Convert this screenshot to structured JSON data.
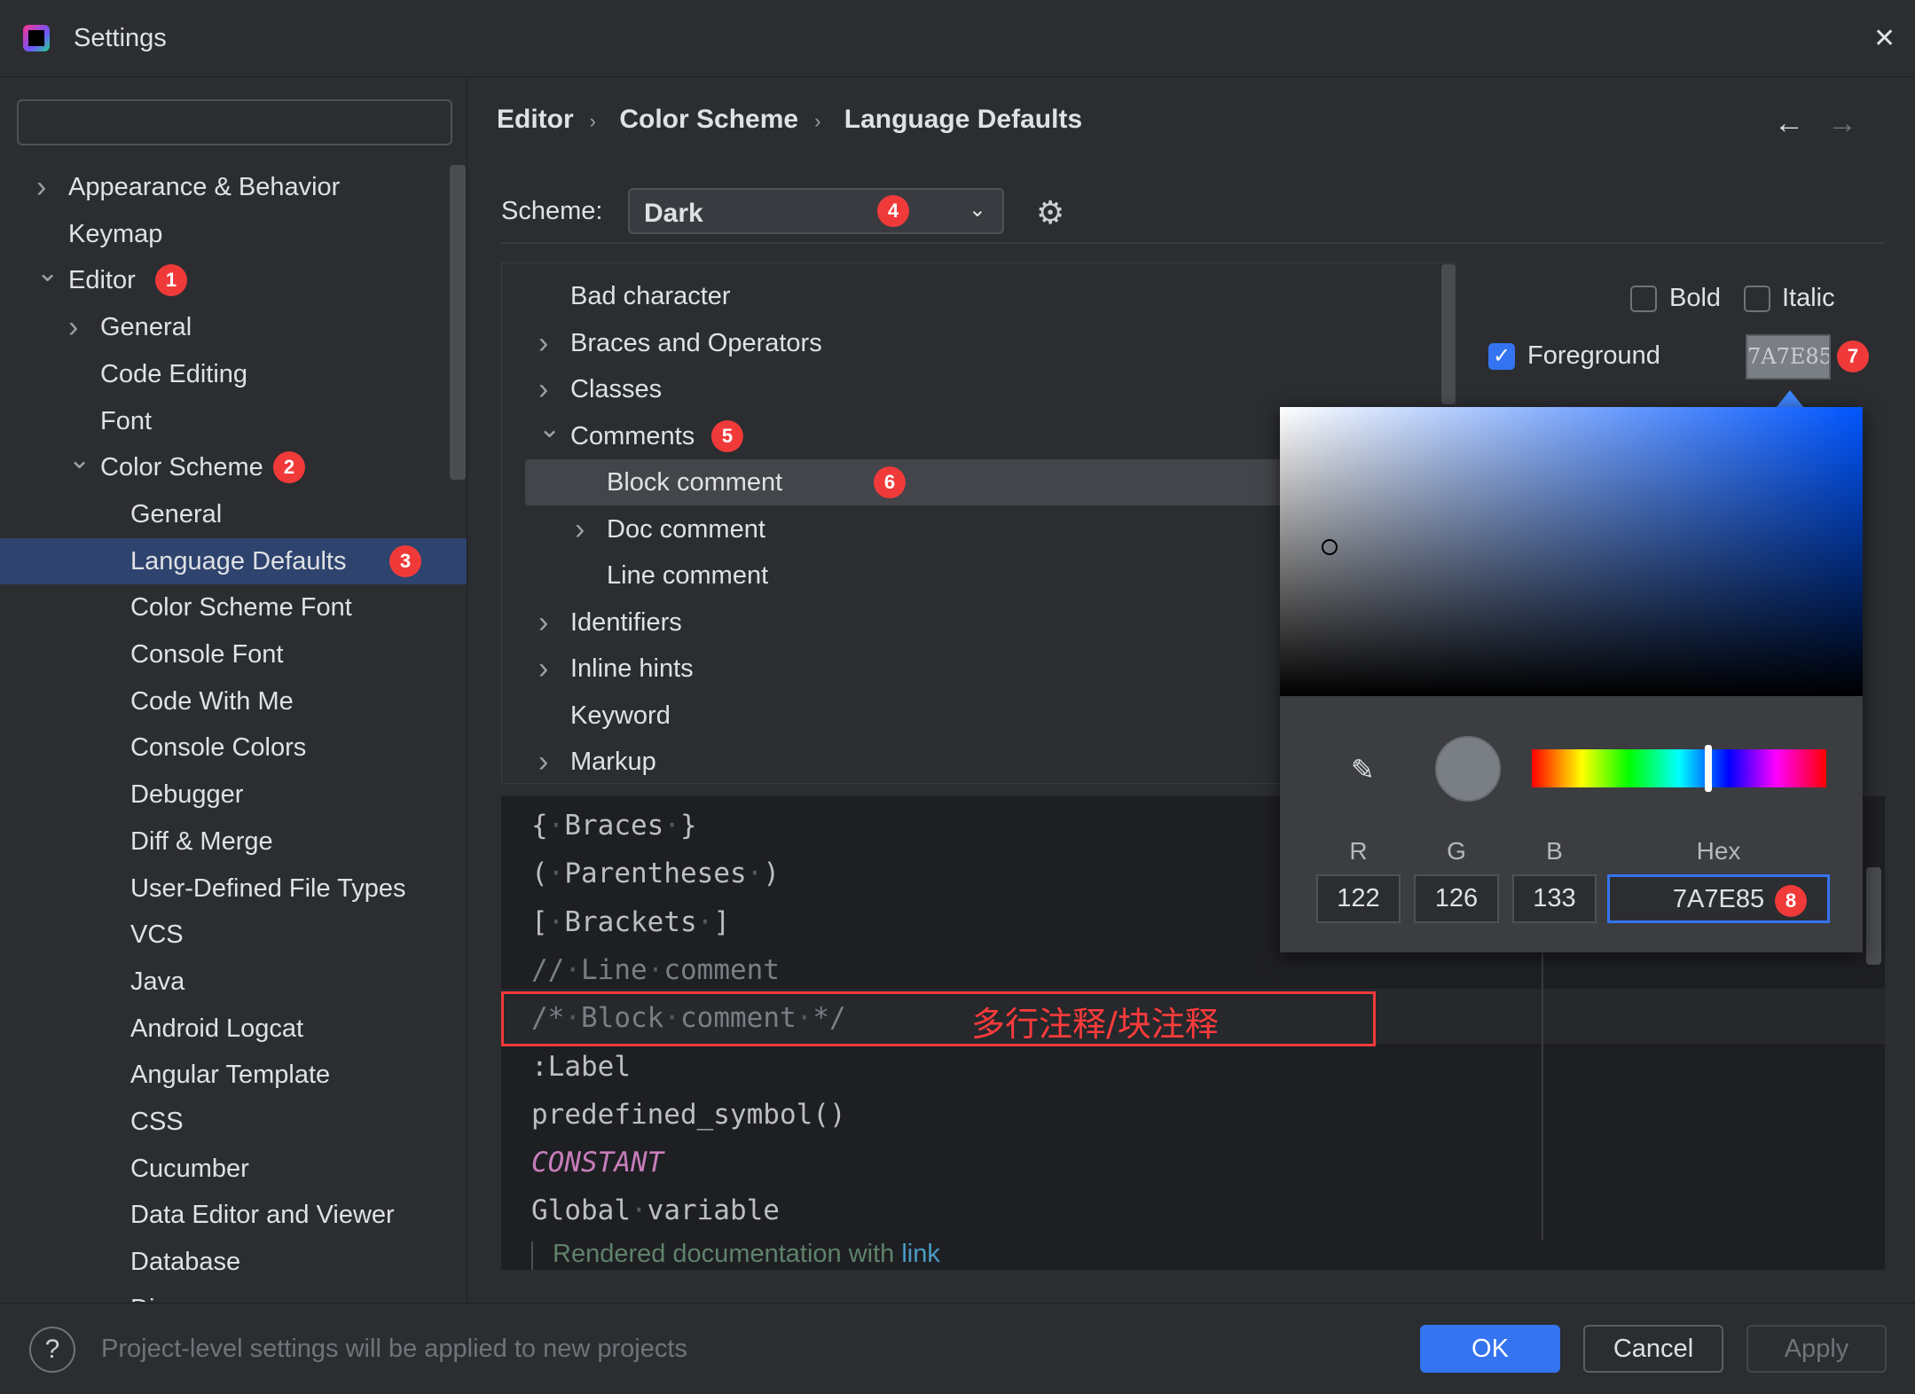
{
  "window": {
    "title": "Settings",
    "close_icon": "close-icon"
  },
  "search": {
    "placeholder": "",
    "value": ""
  },
  "sidebar": {
    "items": [
      {
        "label": "Appearance & Behavior",
        "level": 0,
        "chevron": "right"
      },
      {
        "label": "Keymap",
        "level": 0
      },
      {
        "label": "Editor",
        "level": 0,
        "chevron": "down",
        "badge": "1"
      },
      {
        "label": "General",
        "level": 1,
        "chevron": "right"
      },
      {
        "label": "Code Editing",
        "level": 1
      },
      {
        "label": "Font",
        "level": 1
      },
      {
        "label": "Color Scheme",
        "level": 1,
        "chevron": "down",
        "badge": "2"
      },
      {
        "label": "General",
        "level": 2
      },
      {
        "label": "Language Defaults",
        "level": 2,
        "selected": true,
        "badge": "3"
      },
      {
        "label": "Color Scheme Font",
        "level": 2
      },
      {
        "label": "Console Font",
        "level": 2
      },
      {
        "label": "Code With Me",
        "level": 2
      },
      {
        "label": "Console Colors",
        "level": 2
      },
      {
        "label": "Debugger",
        "level": 2
      },
      {
        "label": "Diff & Merge",
        "level": 2
      },
      {
        "label": "User-Defined File Types",
        "level": 2
      },
      {
        "label": "VCS",
        "level": 2
      },
      {
        "label": "Java",
        "level": 2
      },
      {
        "label": "Android Logcat",
        "level": 2
      },
      {
        "label": "Angular Template",
        "level": 2
      },
      {
        "label": "CSS",
        "level": 2
      },
      {
        "label": "Cucumber",
        "level": 2
      },
      {
        "label": "Data Editor and Viewer",
        "level": 2
      },
      {
        "label": "Database",
        "level": 2
      },
      {
        "label": "Diagrams",
        "level": 2
      }
    ]
  },
  "breadcrumb": [
    "Editor",
    "Color Scheme",
    "Language Defaults"
  ],
  "scheme": {
    "label": "Scheme:",
    "value": "Dark",
    "badge": "4"
  },
  "color_tree": [
    {
      "label": "Bad character",
      "level": 0
    },
    {
      "label": "Braces and Operators",
      "level": 0,
      "chevron": "right"
    },
    {
      "label": "Classes",
      "level": 0,
      "chevron": "right"
    },
    {
      "label": "Comments",
      "level": 0,
      "chevron": "down",
      "badge": "5"
    },
    {
      "label": "Block comment",
      "level": 1,
      "selected": true,
      "badge": "6"
    },
    {
      "label": "Doc comment",
      "level": 1,
      "chevron": "right"
    },
    {
      "label": "Line comment",
      "level": 1
    },
    {
      "label": "Identifiers",
      "level": 0,
      "chevron": "right"
    },
    {
      "label": "Inline hints",
      "level": 0,
      "chevron": "right"
    },
    {
      "label": "Keyword",
      "level": 0
    },
    {
      "label": "Markup",
      "level": 0,
      "chevron": "right"
    }
  ],
  "attributes": {
    "bold": {
      "label": "Bold",
      "checked": false
    },
    "italic": {
      "label": "Italic",
      "checked": false
    },
    "foreground": {
      "label": "Foreground",
      "checked": true,
      "value": "7A7E85",
      "badge": "7"
    }
  },
  "color_picker": {
    "r_label": "R",
    "g_label": "G",
    "b_label": "B",
    "hex_label": "Hex",
    "r": "122",
    "g": "126",
    "b": "133",
    "hex": "7A7E85",
    "badge": "8",
    "color": "#7A7E85"
  },
  "preview": {
    "lines": [
      {
        "text": "{ Braces }",
        "color": "#bcbec4"
      },
      {
        "text": "( Parentheses )",
        "color": "#bcbec4"
      },
      {
        "text": "[ Brackets ]",
        "color": "#bcbec4"
      },
      {
        "text": "// Line comment",
        "color": "#7a7e85"
      },
      {
        "text": "/* Block comment */",
        "color": "#7a7e85"
      },
      {
        "text": ":Label",
        "color": "#bcbec4"
      },
      {
        "text": "predefined_symbol()",
        "color": "#bcbec4"
      },
      {
        "text": "CONSTANT",
        "color": "#c77dbb",
        "italic": true
      },
      {
        "text": "Global variable",
        "color": "#bcbec4"
      }
    ],
    "doc_text": "Rendered documentation with ",
    "doc_link": "link",
    "annotation": "多行注释/块注释"
  },
  "footer": {
    "help": "?",
    "message": "Project-level settings will be applied to new projects",
    "ok": "OK",
    "cancel": "Cancel",
    "apply": "Apply"
  }
}
